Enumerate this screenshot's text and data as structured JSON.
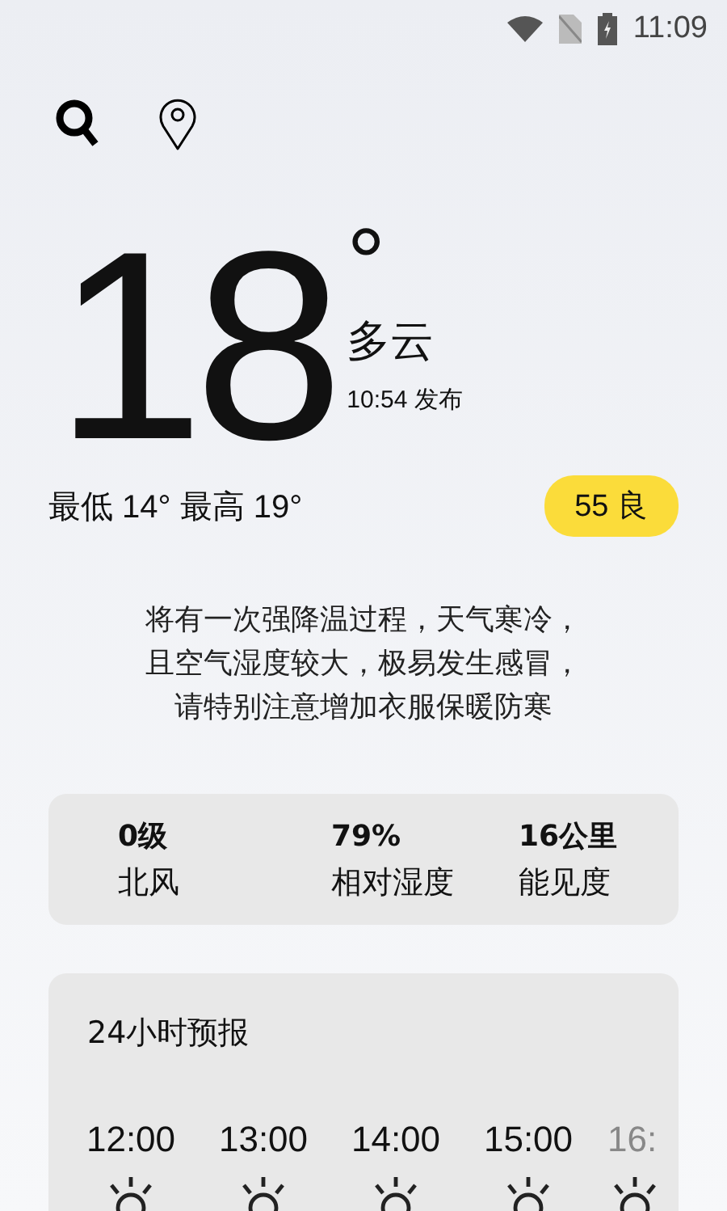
{
  "status_bar": {
    "time": "11:09"
  },
  "current": {
    "temperature": "18",
    "degree": "°",
    "condition": "多云",
    "published": "10:54 发布",
    "low_high": "最低 14° 最高 19°",
    "aqi": "55 良"
  },
  "advice": [
    "将有一次强降温过程，天气寒冷，",
    "且空气湿度较大，极易发生感冒，",
    "请特别注意增加衣服保暖防寒"
  ],
  "details": [
    {
      "value": "0级",
      "label": "北风"
    },
    {
      "value": "79%",
      "label": "相对湿度"
    },
    {
      "value": "16公里",
      "label": "能见度"
    }
  ],
  "forecast": {
    "title": "24小时预报",
    "hours": [
      {
        "time": "12:00",
        "kind": "sunny"
      },
      {
        "time": "13:00",
        "kind": "sunny"
      },
      {
        "time": "14:00",
        "kind": "sunny"
      },
      {
        "time": "15:00",
        "kind": "sunny"
      },
      {
        "time": "16:",
        "kind": "sunny"
      }
    ]
  }
}
